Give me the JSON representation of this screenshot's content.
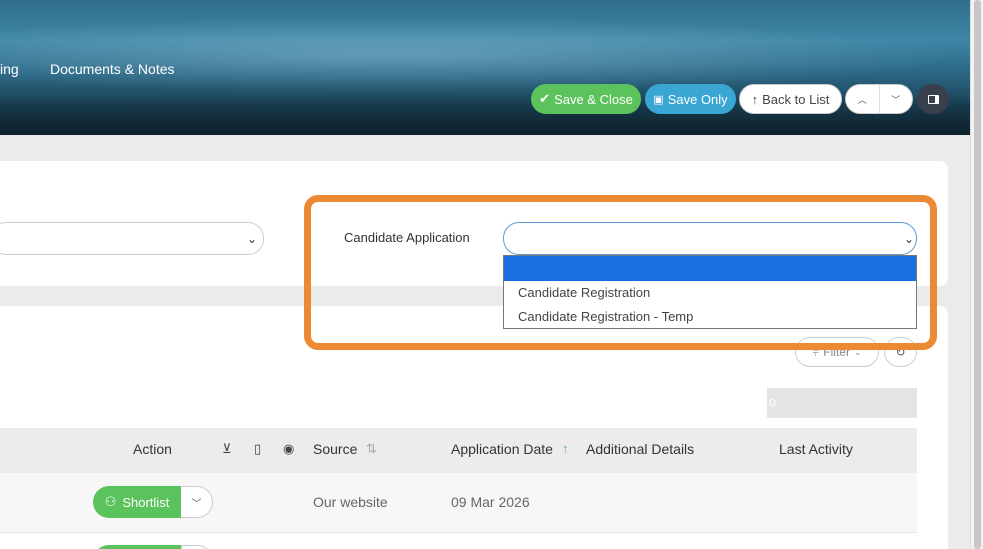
{
  "header": {
    "tabs": [
      {
        "label": "ing"
      },
      {
        "label": "Documents & Notes"
      }
    ],
    "buttons": {
      "save_close": "Save & Close",
      "save_only": "Save Only",
      "back_to_list": "Back to List"
    }
  },
  "form": {
    "candidate_application_label": "Candidate Application",
    "candidate_application_value": "",
    "dropdown_options": [
      "",
      "Candidate Registration",
      "Candidate Registration - Temp"
    ]
  },
  "table": {
    "filter_label": "Filter",
    "count_text": "0",
    "columns": {
      "action": "Action",
      "source": "Source",
      "application_date": "Application Date",
      "additional_details": "Additional Details",
      "last_activity": "Last Activity"
    },
    "rows": [
      {
        "action_label": "Shortlist",
        "source": "Our website",
        "application_date": "09 Mar 2026",
        "additional_details": "",
        "last_activity": ""
      }
    ]
  },
  "colors": {
    "save_close": "#5cc25b",
    "save_only": "#3aa6d4",
    "highlight": "#ec8a34",
    "dropdown_selected": "#1a6fe0"
  }
}
